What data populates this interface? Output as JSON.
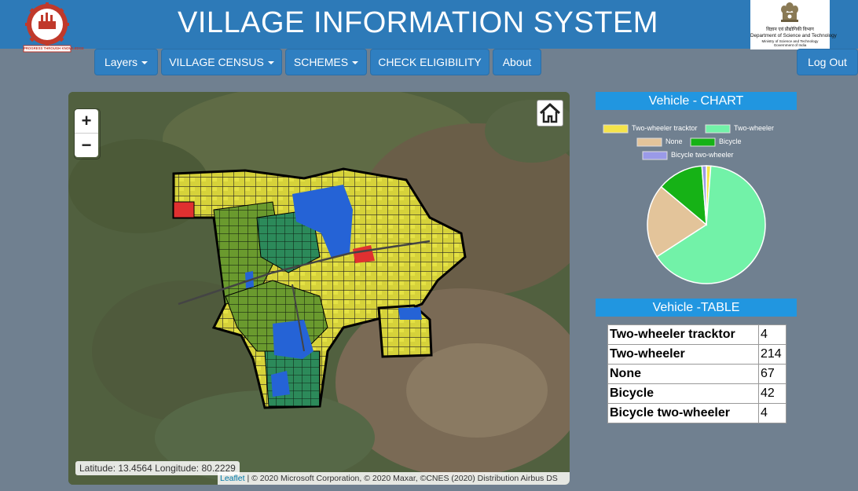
{
  "header": {
    "title": "VILLAGE INFORMATION SYSTEM",
    "left_logo": {
      "motto": "PROGRESS THROUGH KNOWLEDGE",
      "icon": "university-logo-icon"
    },
    "right_logo": {
      "line1": "विज्ञान एवं प्रौद्योगिकी विभाग",
      "line2": "Department of Science and Technology",
      "line3": "Ministry of Science and Technology",
      "line4": "Government of India",
      "icon": "national-emblem-icon"
    }
  },
  "nav": {
    "layers": "Layers",
    "village_census": "VILLAGE CENSUS",
    "schemes": "SCHEMES",
    "check_eligibility": "CHECK ELIGIBILITY",
    "about": "About",
    "logout": "Log Out"
  },
  "map": {
    "zoom_in": "+",
    "zoom_out": "−",
    "home_icon": "home-icon",
    "coords": "Latitude: 13.4564 Longitude: 80.2229",
    "attribution_link": "Leaflet",
    "attribution_text": " | © 2020 Microsoft Corporation, © 2020 Maxar, ©CNES (2020) Distribution Airbus DS"
  },
  "chart_section": {
    "title": "Vehicle - CHART"
  },
  "table_section": {
    "title": "Vehicle -TABLE"
  },
  "chart_data": {
    "type": "pie",
    "categories": [
      "Two-wheeler tracktor",
      "Two-wheeler",
      "None",
      "Bicycle",
      "Bicycle two-wheeler"
    ],
    "values": [
      4,
      214,
      67,
      42,
      4
    ],
    "colors": [
      "#f5e44a",
      "#72f2a8",
      "#e3c49a",
      "#16b216",
      "#9a9ae8"
    ],
    "legend_position": "top"
  },
  "table": {
    "rows": [
      {
        "label": "Two-wheeler tracktor",
        "value": "4"
      },
      {
        "label": "Two-wheeler",
        "value": "214"
      },
      {
        "label": "None",
        "value": "67"
      },
      {
        "label": "Bicycle",
        "value": "42"
      },
      {
        "label": "Bicycle two-wheeler",
        "value": "4"
      }
    ]
  },
  "colors": {
    "header": "#2d7ab8",
    "nav_button": "#2f7fc1",
    "section_title": "#2196e0",
    "background": "#708090"
  }
}
